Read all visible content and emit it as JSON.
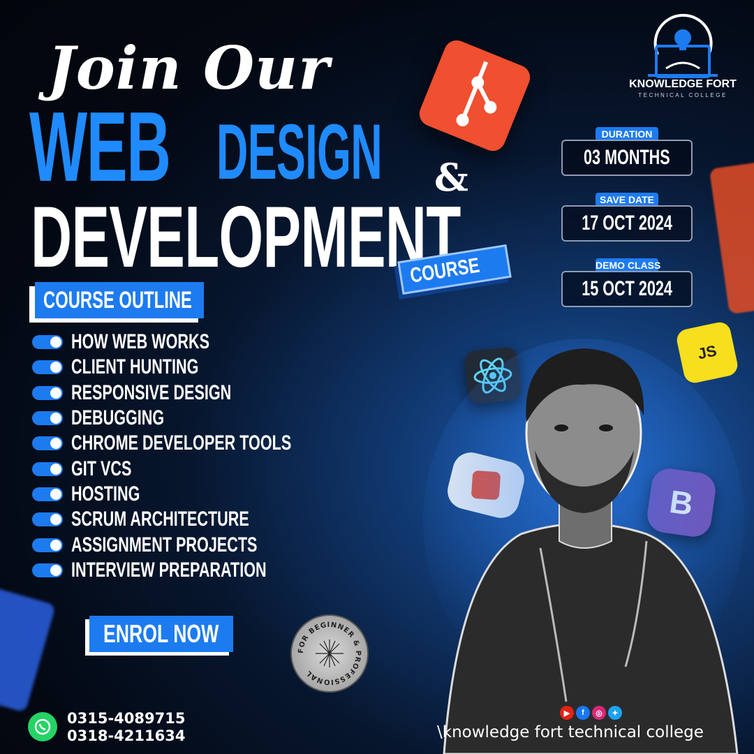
{
  "headline": {
    "script_line": "Join Our",
    "word1": "WEB",
    "word2": "DESIGN",
    "ampersand": "&",
    "word3": "DEVELOPMENT",
    "badge": "COURSE"
  },
  "outline": {
    "title": "COURSE OUTLINE",
    "items": [
      "HOW WEB WORKS",
      "CLIENT HUNTING",
      "RESPONSIVE DESIGN",
      "DEBUGGING",
      "CHROME DEVELOPER TOOLS",
      "GIT VCS",
      "HOSTING",
      "SCRUM ARCHITECTURE",
      "ASSIGNMENT PROJECTS",
      "INTERVIEW PREPARATION"
    ]
  },
  "cta": {
    "enrol_label": "ENROL NOW"
  },
  "seal": {
    "text": "FOR BEGINNER & PROFESSIONAL"
  },
  "contact": {
    "phones": [
      "0315-4089715",
      "0318-4211634"
    ]
  },
  "brand": {
    "logo_name": "KNOWLEDGE FORT",
    "logo_sub": "TECHNICAL COLLEGE",
    "footer": "\\knowledge fort technical college"
  },
  "info": [
    {
      "label": "DURATION",
      "value": "03 MONTHS"
    },
    {
      "label": "SAVE DATE",
      "value": "17 OCT 2024"
    },
    {
      "label": "DEMO CLASS",
      "value": "15 OCT 2024"
    }
  ],
  "icons": {
    "js_text": "JS",
    "bootstrap_text": "B"
  },
  "colors": {
    "accent": "#1d7bf0",
    "background": "#030812"
  }
}
